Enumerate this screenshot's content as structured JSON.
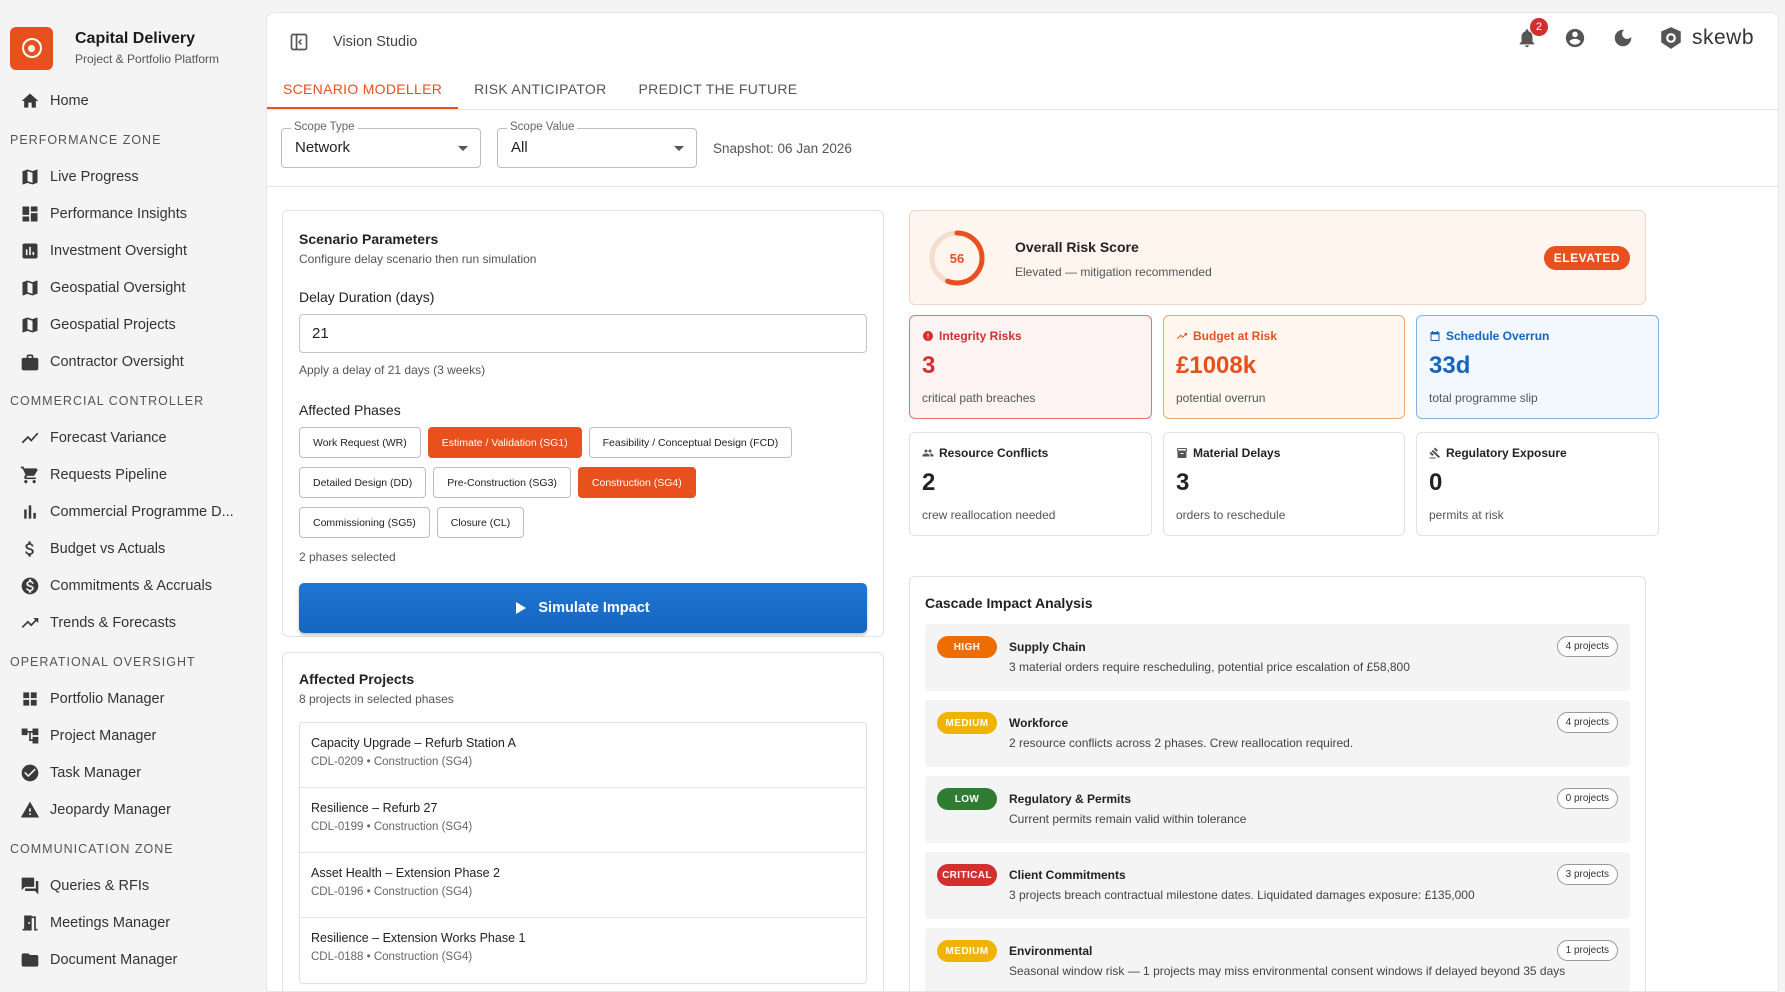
{
  "brand": {
    "title": "Capital Delivery",
    "subtitle": "Project & Portfolio Platform"
  },
  "sidebar": {
    "home": "Home",
    "sections": [
      {
        "title": "PERFORMANCE ZONE",
        "items": [
          "Live Progress",
          "Performance Insights",
          "Investment Oversight",
          "Geospatial Oversight",
          "Geospatial Projects",
          "Contractor Oversight"
        ]
      },
      {
        "title": "COMMERCIAL CONTROLLER",
        "items": [
          "Forecast Variance",
          "Requests Pipeline",
          "Commercial Programme D...",
          "Budget vs Actuals",
          "Commitments & Accruals",
          "Trends & Forecasts"
        ]
      },
      {
        "title": "OPERATIONAL OVERSIGHT",
        "items": [
          "Portfolio Manager",
          "Project Manager",
          "Task Manager",
          "Jeopardy Manager"
        ]
      },
      {
        "title": "COMMUNICATION ZONE",
        "items": [
          "Queries & RFIs",
          "Meetings Manager",
          "Document Manager"
        ]
      }
    ]
  },
  "header": {
    "app_name": "Vision Studio",
    "notifications": "2",
    "logo_text": "skewb"
  },
  "tabs": [
    "SCENARIO MODELLER",
    "RISK ANTICIPATOR",
    "PREDICT THE FUTURE"
  ],
  "filters": {
    "scope_type": {
      "label": "Scope Type",
      "value": "Network"
    },
    "scope_value": {
      "label": "Scope Value",
      "value": "All"
    },
    "snapshot": "Snapshot: 06 Jan 2026"
  },
  "params": {
    "title": "Scenario Parameters",
    "subtitle": "Configure delay scenario then run simulation",
    "delay_label": "Delay Duration (days)",
    "delay_value": "21",
    "delay_hint": "Apply a delay of 21 days (3 weeks)",
    "phases_label": "Affected Phases",
    "phases": [
      {
        "label": "Work Request (WR)",
        "selected": false
      },
      {
        "label": "Estimate / Validation (SG1)",
        "selected": true
      },
      {
        "label": "Feasibility / Conceptual Design (FCD)",
        "selected": false
      },
      {
        "label": "Detailed Design (DD)",
        "selected": false
      },
      {
        "label": "Pre-Construction (SG3)",
        "selected": false
      },
      {
        "label": "Construction (SG4)",
        "selected": true
      },
      {
        "label": "Commissioning (SG5)",
        "selected": false
      },
      {
        "label": "Closure (CL)",
        "selected": false
      }
    ],
    "phases_count": "2 phases selected",
    "simulate_label": "Simulate Impact"
  },
  "projects": {
    "title": "Affected Projects",
    "subtitle": "8 projects in selected phases",
    "items": [
      {
        "name": "Capacity Upgrade – Refurb Station A",
        "meta": "CDL-0209 • Construction (SG4)"
      },
      {
        "name": "Resilience – Refurb 27",
        "meta": "CDL-0199 • Construction (SG4)"
      },
      {
        "name": "Asset Health – Extension Phase 2",
        "meta": "CDL-0196 • Construction (SG4)"
      },
      {
        "name": "Resilience – Extension Works Phase 1",
        "meta": "CDL-0188 • Construction (SG4)"
      }
    ]
  },
  "risk": {
    "score": "56",
    "score_fraction": 0.56,
    "title": "Overall Risk Score",
    "subtitle": "Elevated — mitigation recommended",
    "badge": "ELEVATED",
    "accent": "#e8501e"
  },
  "metrics": [
    {
      "title": "Integrity Risks",
      "value": "3",
      "sub": "critical path breaches",
      "icon": "alert-circle-icon"
    },
    {
      "title": "Budget at Risk",
      "value": "£1008k",
      "sub": "potential overrun",
      "icon": "trending-up-icon"
    },
    {
      "title": "Schedule Overrun",
      "value": "33d",
      "sub": "total programme slip",
      "icon": "calendar-icon"
    },
    {
      "title": "Resource Conflicts",
      "value": "2",
      "sub": "crew reallocation needed",
      "icon": "people-icon"
    },
    {
      "title": "Material Delays",
      "value": "3",
      "sub": "orders to reschedule",
      "icon": "inventory-icon"
    },
    {
      "title": "Regulatory Exposure",
      "value": "0",
      "sub": "permits at risk",
      "icon": "gavel-icon"
    }
  ],
  "cascade": {
    "title": "Cascade Impact Analysis",
    "items": [
      {
        "severity": "HIGH",
        "title": "Supply Chain",
        "desc": "3 material orders require rescheduling, potential price escalation of £58,800",
        "count": "4 projects"
      },
      {
        "severity": "MEDIUM",
        "title": "Workforce",
        "desc": "2 resource conflicts across 2 phases. Crew reallocation required.",
        "count": "4 projects"
      },
      {
        "severity": "LOW",
        "title": "Regulatory & Permits",
        "desc": "Current permits remain valid within tolerance",
        "count": "0 projects"
      },
      {
        "severity": "CRITICAL",
        "title": "Client Commitments",
        "desc": "3 projects breach contractual milestone dates. Liquidated damages exposure: £135,000",
        "count": "3 projects"
      },
      {
        "severity": "MEDIUM",
        "title": "Environmental",
        "desc": "Seasonal window risk — 1 projects may miss environmental consent windows if delayed beyond 35 days",
        "count": "1 projects"
      }
    ]
  }
}
